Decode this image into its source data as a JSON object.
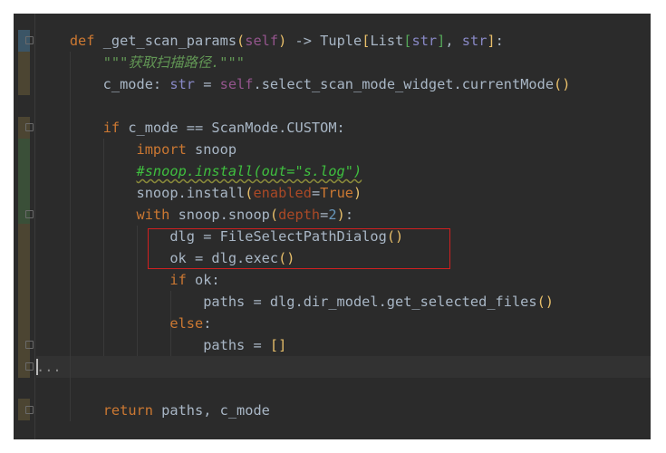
{
  "editor": {
    "lines": [
      [
        [
          "    ",
          ""
        ],
        [
          "def",
          "kw"
        ],
        [
          " _get_scan_params",
          ""
        ],
        [
          "(",
          "b1"
        ],
        [
          "self",
          "self"
        ],
        [
          "",
          ""
        ],
        [
          ")",
          "b1"
        ],
        [
          " -> Tuple",
          ""
        ],
        [
          "[",
          "b1"
        ],
        [
          "List",
          ""
        ],
        [
          "[",
          "b2"
        ],
        [
          "str",
          "ty"
        ],
        [
          "]",
          "b2"
        ],
        [
          ", ",
          ""
        ],
        [
          "str",
          "ty"
        ],
        [
          "]",
          "b1"
        ],
        [
          ":",
          ""
        ]
      ],
      [
        [
          "        ",
          ""
        ],
        [
          "\"\"\"获取扫描路径.\"\"\"",
          "doc"
        ]
      ],
      [
        [
          "        c_mode: ",
          ""
        ],
        [
          "str",
          "ty"
        ],
        [
          " = ",
          ""
        ],
        [
          "self",
          "self"
        ],
        [
          ".select_scan_mode_widget.currentMode",
          ""
        ],
        [
          "()",
          "b1"
        ]
      ],
      [
        [
          "",
          ""
        ]
      ],
      [
        [
          "        ",
          ""
        ],
        [
          "if",
          "kw"
        ],
        [
          " c_mode == ScanMode.CUSTOM:",
          ""
        ]
      ],
      [
        [
          "            ",
          ""
        ],
        [
          "import",
          "kw"
        ],
        [
          " snoop",
          ""
        ]
      ],
      [
        [
          "            ",
          ""
        ],
        [
          "#snoop.install(out=\"s.log\")",
          "cm"
        ]
      ],
      [
        [
          "            snoop.install",
          ""
        ],
        [
          "(",
          "b1"
        ],
        [
          "enabled",
          "par"
        ],
        [
          "=",
          ""
        ],
        [
          "True",
          "kw"
        ],
        [
          ")",
          "b1"
        ]
      ],
      [
        [
          "            ",
          ""
        ],
        [
          "with",
          "kw"
        ],
        [
          " snoop.snoop",
          ""
        ],
        [
          "(",
          "b1"
        ],
        [
          "depth",
          "par"
        ],
        [
          "=",
          ""
        ],
        [
          "2",
          "num"
        ],
        [
          ")",
          "b1"
        ],
        [
          ":",
          ""
        ]
      ],
      [
        [
          "                dlg = FileSelectPathDialog",
          ""
        ],
        [
          "()",
          "b1"
        ]
      ],
      [
        [
          "                ok = dlg.exec",
          ""
        ],
        [
          "()",
          "b1"
        ]
      ],
      [
        [
          "                ",
          ""
        ],
        [
          "if",
          "kw"
        ],
        [
          " ok:",
          ""
        ]
      ],
      [
        [
          "                    paths = dlg.dir_model.get_selected_files",
          ""
        ],
        [
          "()",
          "b1"
        ]
      ],
      [
        [
          "                ",
          ""
        ],
        [
          "else",
          "kw"
        ],
        [
          ":",
          ""
        ]
      ],
      [
        [
          "                    paths = ",
          ""
        ],
        [
          "[]",
          "b1"
        ]
      ],
      [
        [
          "...",
          "fold-t"
        ]
      ],
      [
        [
          "",
          ""
        ]
      ],
      [
        [
          "        ",
          ""
        ],
        [
          "return",
          "kw"
        ],
        [
          " paths, c_mode",
          ""
        ]
      ]
    ]
  }
}
